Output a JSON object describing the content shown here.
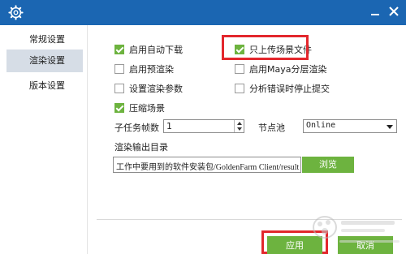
{
  "window": {
    "title_icon": "gear-icon",
    "controls": [
      "minimize-icon",
      "close-icon"
    ]
  },
  "sidebar": {
    "items": [
      {
        "label": "常规设置",
        "active": false
      },
      {
        "label": "渲染设置",
        "active": true
      },
      {
        "label": "版本设置",
        "active": false
      }
    ]
  },
  "render": {
    "options": [
      {
        "label": "启用自动下载",
        "checked": true
      },
      {
        "label": "只上传场景文件",
        "checked": true
      },
      {
        "label": "启用预渲染",
        "checked": false
      },
      {
        "label": "启用Maya分层渲染",
        "checked": false
      },
      {
        "label": "设置渲染参数",
        "checked": false
      },
      {
        "label": "分析错误时停止提交",
        "checked": false
      },
      {
        "label": "压缩场景",
        "checked": true
      }
    ],
    "subtask_frames_label": "子任务帧数",
    "subtask_frames_value": "1",
    "node_pool_label": "节点池",
    "node_pool_value": "Online",
    "output_dir_label": "渲染输出目录",
    "output_dir_value": "工作中要用到的软件安装包/GoldenFarm Client/result",
    "browse_label": "浏览"
  },
  "footer": {
    "apply_label": "应用",
    "cancel_label": "取消"
  },
  "colors": {
    "titlebar": "#1b66b2",
    "accent_green": "#6db33f",
    "highlight_red": "#e3272d",
    "active_nav": "#d6dde6"
  }
}
